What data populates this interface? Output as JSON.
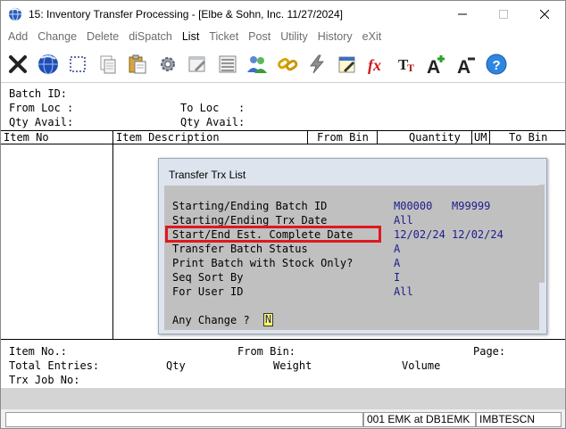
{
  "window": {
    "title": "15: Inventory Transfer Processing - [Elbe & Sohn, Inc. 11/27/2024]"
  },
  "menu": [
    "Add",
    "Change",
    "Delete",
    "diSpatch",
    "List",
    "Ticket",
    "Post",
    "Utility",
    "History",
    "eXit"
  ],
  "menu_active": "List",
  "toolbar": {
    "icons": [
      "close-x-icon",
      "globe-icon",
      "select-rect-icon",
      "copy-icon",
      "paste-icon",
      "gear-icon",
      "edit-window-icon",
      "list-icon",
      "users-icon",
      "chain-link-icon",
      "lightning-icon",
      "calendar-edit-icon",
      "fx-icon",
      "font-size-icon",
      "increase-font-icon",
      "decrease-font-icon",
      "help-icon"
    ]
  },
  "header_fields": {
    "batch_id": "Batch ID:",
    "from_loc": "From Loc :",
    "to_loc": "To Loc   :",
    "qty_avail_left": "Qty Avail:",
    "qty_avail_right": "Qty Avail:"
  },
  "grid": {
    "columns": [
      "Item No",
      "Item Description",
      "From Bin",
      "Quantity",
      "UM",
      "To Bin"
    ]
  },
  "dialog": {
    "title": "Transfer Trx List",
    "rows": [
      {
        "label": "Starting/Ending Batch ID",
        "value": "M00000   M99999"
      },
      {
        "label": "Starting/Ending Trx Date",
        "value": "All"
      },
      {
        "label": "Start/End Est. Complete Date",
        "value": "12/02/24 12/02/24"
      },
      {
        "label": "Transfer Batch Status",
        "value": "A"
      },
      {
        "label": "Print Batch with Stock Only?",
        "value": "A"
      },
      {
        "label": "Seq Sort By",
        "value": "I"
      },
      {
        "label": "For User ID",
        "value": "All"
      }
    ],
    "prompt": "Any Change ?",
    "prompt_value": "N",
    "highlight_color": "#e0181e"
  },
  "footer_fields": {
    "item_no": "Item No.:",
    "from_bin": "From Bin:",
    "page": "Page:",
    "total_entries": "Total Entries:",
    "qty": "Qty",
    "weight": "Weight",
    "volume": "Volume",
    "trx_job_no": "Trx Job No:"
  },
  "statusbar": {
    "user": "001 EMK at DB1EMK",
    "server": "IMBTESCN"
  }
}
